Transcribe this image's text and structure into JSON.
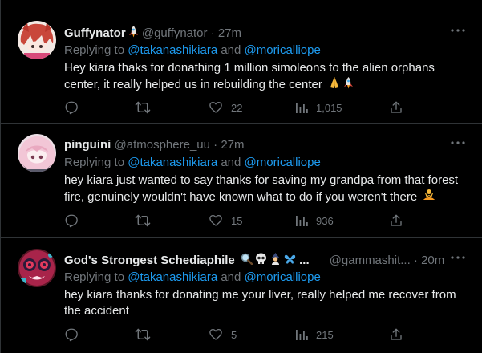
{
  "colors": {
    "background": "#000000",
    "text": "#e7e9ea",
    "muted": "#71767b",
    "link": "#1d9bf0",
    "divider": "#2f3336"
  },
  "tweets": [
    {
      "name": "Guffynator",
      "name_emoji_icons": [
        "rocket-icon"
      ],
      "handle": "@guffynator",
      "separator": "·",
      "time": "27m",
      "replying_prefix": "Replying to",
      "replying_to_1": "@takanashikiara",
      "replying_and": "and",
      "replying_to_2": "@moricalliope",
      "text": "Hey kiara thaks for donathing 1 million simoleons to the alien orphans center, it really helped us in rebuilding the center",
      "text_emoji_icons": [
        "folded-hands-icon",
        "rocket-icon"
      ],
      "replies": "",
      "retweets": "",
      "likes": "22",
      "views": "1,015"
    },
    {
      "name": "pinguini",
      "handle": "@atmosphere_uu",
      "separator": "·",
      "time": "27m",
      "replying_prefix": "Replying to",
      "replying_to_1": "@takanashikiara",
      "replying_and": "and",
      "replying_to_2": "@moricalliope",
      "text_line_1": "hey kiara just wanted to say thanks for saving my grandpa from that forest",
      "text_line_2": "fire, genuinely wouldn't have known what to do if you weren't there",
      "text_emoji_icons": [
        "person-in-lotus-position-icon"
      ],
      "replies": "",
      "retweets": "",
      "likes": "15",
      "views": "936"
    },
    {
      "name": "God's Strongest Schediaphile",
      "name_emoji_icons": [
        "magnifying-glass-icon",
        "skull-icon",
        "mage-icon",
        "butterfly-icon"
      ],
      "name_ellipsis": "...",
      "handle": "@gammashit...",
      "separator": "·",
      "time": "20m",
      "replying_prefix": "Replying to",
      "replying_to_1": "@takanashikiara",
      "replying_and": "and",
      "replying_to_2": "@moricalliope",
      "text_line_1": "hey kiara thanks for donating me your liver, really helped me recover from",
      "text_line_2": "the accident",
      "replies": "",
      "retweets": "",
      "likes": "5",
      "views": "215"
    }
  ]
}
